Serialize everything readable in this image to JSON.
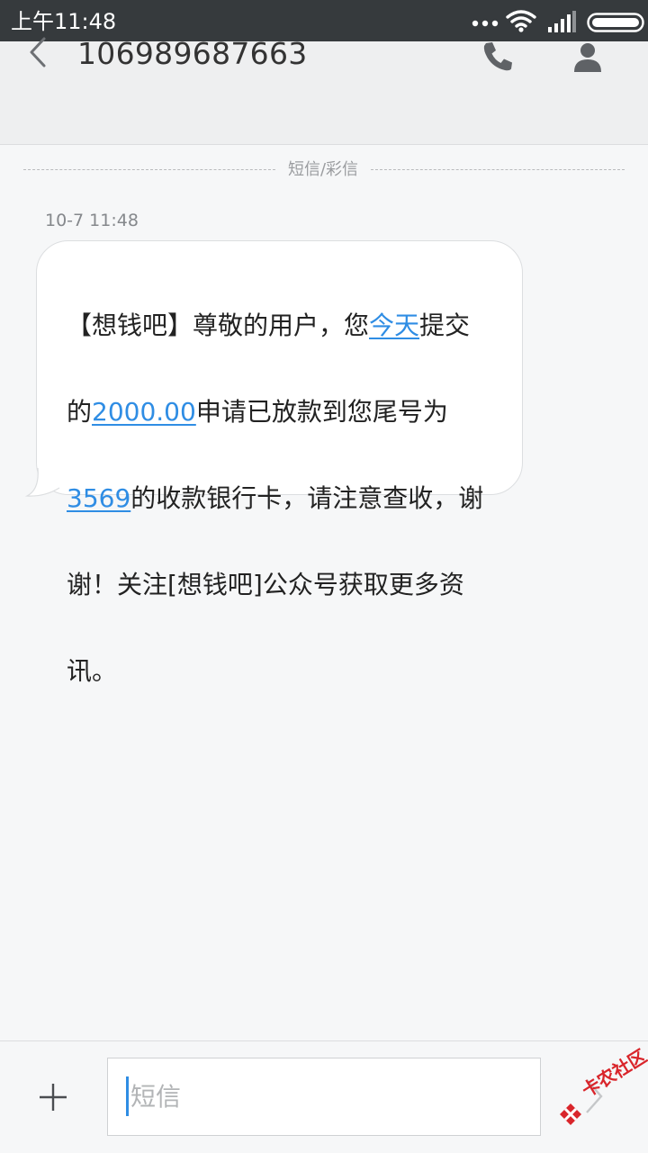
{
  "status_bar": {
    "time": "上午11:48",
    "icons": [
      "more-dots-icon",
      "wifi-icon",
      "signal-icon",
      "battery-icon"
    ]
  },
  "header": {
    "title": "106989687663",
    "icons": [
      "back-icon",
      "phone-icon",
      "contact-icon"
    ]
  },
  "conversation": {
    "divider_label": "短信/彩信",
    "timestamp": "10-7 11:48",
    "message": {
      "line1_pre": "【想钱吧】尊敬的用户，您",
      "line1_link": "今天",
      "line1_post": "提交",
      "line2_pre": "的",
      "line2_link": "2000.00",
      "line2_post": "申请已放款到您尾号为",
      "line3_link": "3569",
      "line3_post": "的收款银行卡，请注意查收，谢",
      "line4": "谢！关注[想钱吧]公众号获取更多资",
      "line5": "讯。"
    }
  },
  "composer": {
    "placeholder": "短信",
    "value": ""
  },
  "watermark": {
    "text": "卡农社区"
  },
  "colors": {
    "status_bar": "#363a3d",
    "link": "#2f8de4",
    "watermark": "#d9252b"
  }
}
